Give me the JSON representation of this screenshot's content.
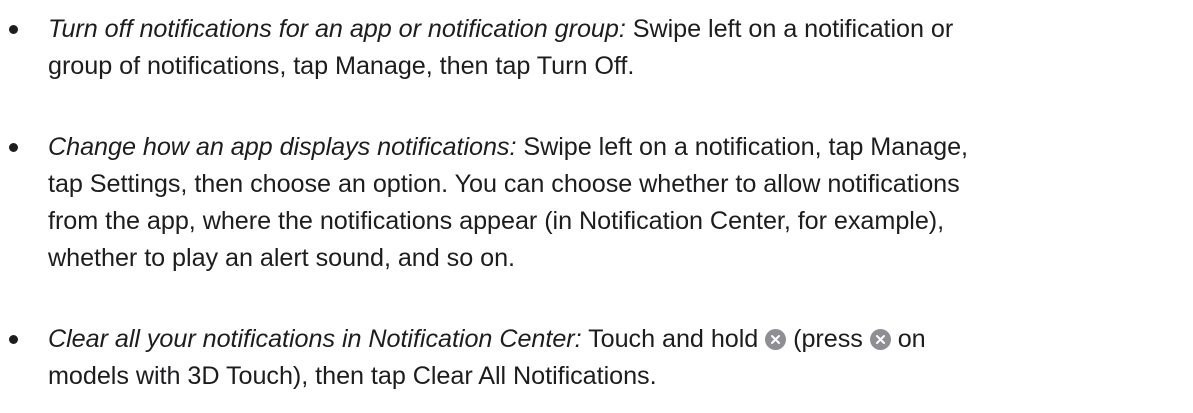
{
  "items": [
    {
      "label": "Turn off notifications for an app or notification group:",
      "line1": " Swipe left on a notification or",
      "line2": "group of notifications, tap Manage, then tap Turn Off."
    },
    {
      "label": "Change how an app displays notifications:",
      "line1": " Swipe left on a notification, tap Manage,",
      "line2": "tap Settings, then choose an option. You can choose whether to allow notifications",
      "line3": "from the app, where the notifications appear (in Notification Center, for example),",
      "line4": "whether to play an alert sound, and so on."
    },
    {
      "label": "Clear all your notifications in Notification Center:",
      "part1": " Touch and hold ",
      "part2": " (press ",
      "part3": " on",
      "line2": "models with 3D Touch), then tap Clear All Notifications.",
      "icon1": "clear-x-icon",
      "icon2": "clear-x-icon"
    }
  ],
  "colors": {
    "text": "#1d1d1f",
    "icon_bg": "#8e8e93",
    "icon_glyph": "#ffffff"
  }
}
